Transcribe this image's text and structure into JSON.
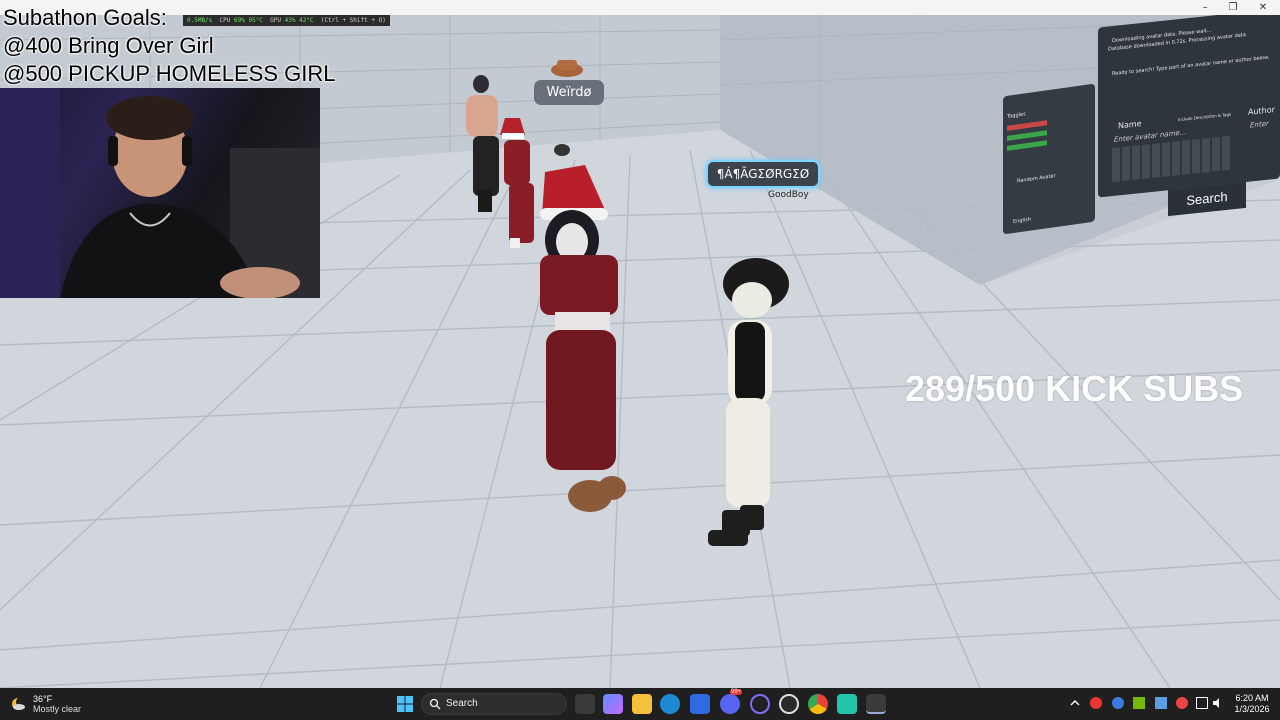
{
  "overlay": {
    "goals_title": "Subathon Goals:",
    "goal_1": "@400 Bring Over Girl",
    "goal_2": "@500 PICKUP HOMELESS GIRL",
    "kick_subs": "289/500 KICK SUBS"
  },
  "window": {
    "minimize": "–",
    "maximize": "❐",
    "close": "✕"
  },
  "perf_overlay": {
    "net": "0.5MB/s",
    "cpu_label": "CPU",
    "cpu_pct": "69%",
    "cpu_temp": "95°C",
    "gpu_label": "GPU",
    "gpu_pct": "43%",
    "gpu_temp": "42°C",
    "hotkey": "(Ctrl + Shift + O)"
  },
  "nameplates": {
    "weirdo": "Weïrdø",
    "goodboy_title": "¶Á¶ÃGΣØRGΣØ",
    "goodboy_sub": "GoodBoy"
  },
  "world_menu": {
    "status_1": "Downloading avatar data. Please wait...",
    "status_2": "Database downloaded in 0.72s. Processing avatar data",
    "hint": "Ready to search! Type part of an avatar name or author below.",
    "name_label": "Name",
    "author_label": "Author",
    "name_placeholder": "Enter avatar name...",
    "author_placeholder": "Enter",
    "include_desc": "Include Description & Tags",
    "search_button": "Search",
    "random_avatar": "Random Avatar",
    "toggles_label": "Toggles",
    "language_value": "English"
  },
  "taskbar": {
    "weather_temp": "36°F",
    "weather_desc": "Mostly clear",
    "search_label": "Search",
    "time": "6:20 AM",
    "date": "1/3/2026",
    "badge": "99+"
  },
  "colors": {
    "taskbar_bg": "#1f1f1f",
    "floor": "#d3d8de",
    "wall": "#c6ccd4",
    "accent_cyan": "#7fd4ff"
  }
}
